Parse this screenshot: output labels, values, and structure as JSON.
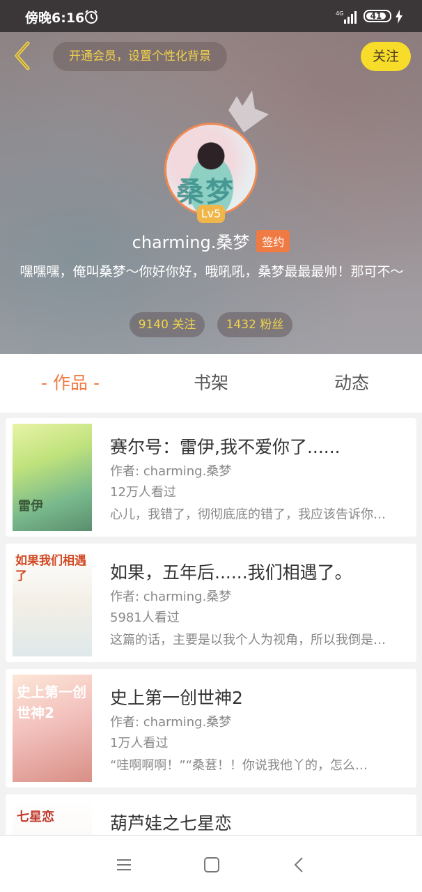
{
  "status_bar": {
    "time": "傍晚6:16",
    "network": "4G",
    "battery": "41",
    "icons": [
      "alarm-icon",
      "signal-icon",
      "battery-icon",
      "charging-icon"
    ]
  },
  "header": {
    "back_icon": "chevron-left-icon",
    "vip_prompt": "开通会员，设置个性化背景",
    "follow_label": "关注",
    "avatar_text": "桑梦",
    "level": "Lv5",
    "username": "charming.桑梦",
    "signed_label": "签约",
    "bio": "嘿嘿嘿，俺叫桑梦～你好你好，哦吼吼，桑梦最最最帅！那可不～",
    "following": "9140 关注",
    "followers": "1432 粉丝",
    "colors": {
      "accent_yellow": "#f7dc2a",
      "accent_orange": "#f07a43"
    }
  },
  "tabs": [
    {
      "label": "- 作品 -",
      "active": true
    },
    {
      "label": "书架",
      "active": false
    },
    {
      "label": "动态",
      "active": false
    }
  ],
  "books": [
    {
      "title": "赛尔号：雷伊,我不爱你了......",
      "author": "作者: charming.桑梦",
      "views": "12万人看过",
      "desc": "心儿，我错了，彻彻底底的错了，我应该告诉你的…"
    },
    {
      "title": "如果，五年后......我们相遇了。",
      "author": "作者: charming.桑梦",
      "views": "5981人看过",
      "desc": "这篇的话，主要是以我个人为视角，所以我倒是…"
    },
    {
      "title": "史上第一创世神2",
      "author": "作者: charming.桑梦",
      "views": "1万人看过",
      "desc": "“哇啊啊啊！”“桑葚！！你说我他丫的，怎么…"
    },
    {
      "title": "葫芦娃之七星恋",
      "author": "",
      "views": "",
      "desc": ""
    }
  ],
  "covers": [
    {
      "text": "雷伊"
    },
    {
      "text": "如果我们相遇了"
    },
    {
      "text": "史上第一创世神2"
    },
    {
      "text": "七星恋"
    }
  ],
  "navbar": {
    "icons": [
      "menu-icon",
      "home-icon",
      "back-icon"
    ]
  }
}
